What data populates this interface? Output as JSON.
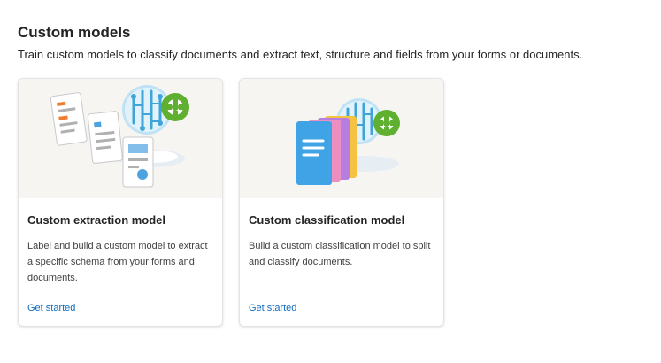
{
  "section": {
    "title": "Custom models",
    "description": "Train custom models to classify documents and extract text, structure and fields from your forms or documents."
  },
  "cards": [
    {
      "title": "Custom extraction model",
      "description": "Label and build a custom model to extract a specific schema from your forms and documents.",
      "link": "Get started",
      "illustration": "documents-with-brain-gear-icon"
    },
    {
      "title": "Custom classification model",
      "description": "Build a custom classification model to split and classify documents.",
      "link": "Get started",
      "illustration": "stacked-folders-with-brain-gear-icon"
    }
  ],
  "colors": {
    "link": "#0f6cbd",
    "hero_bg": "#f7f5f2",
    "gear_green": "#5fb030",
    "brain_blue": "#40a4d8"
  }
}
